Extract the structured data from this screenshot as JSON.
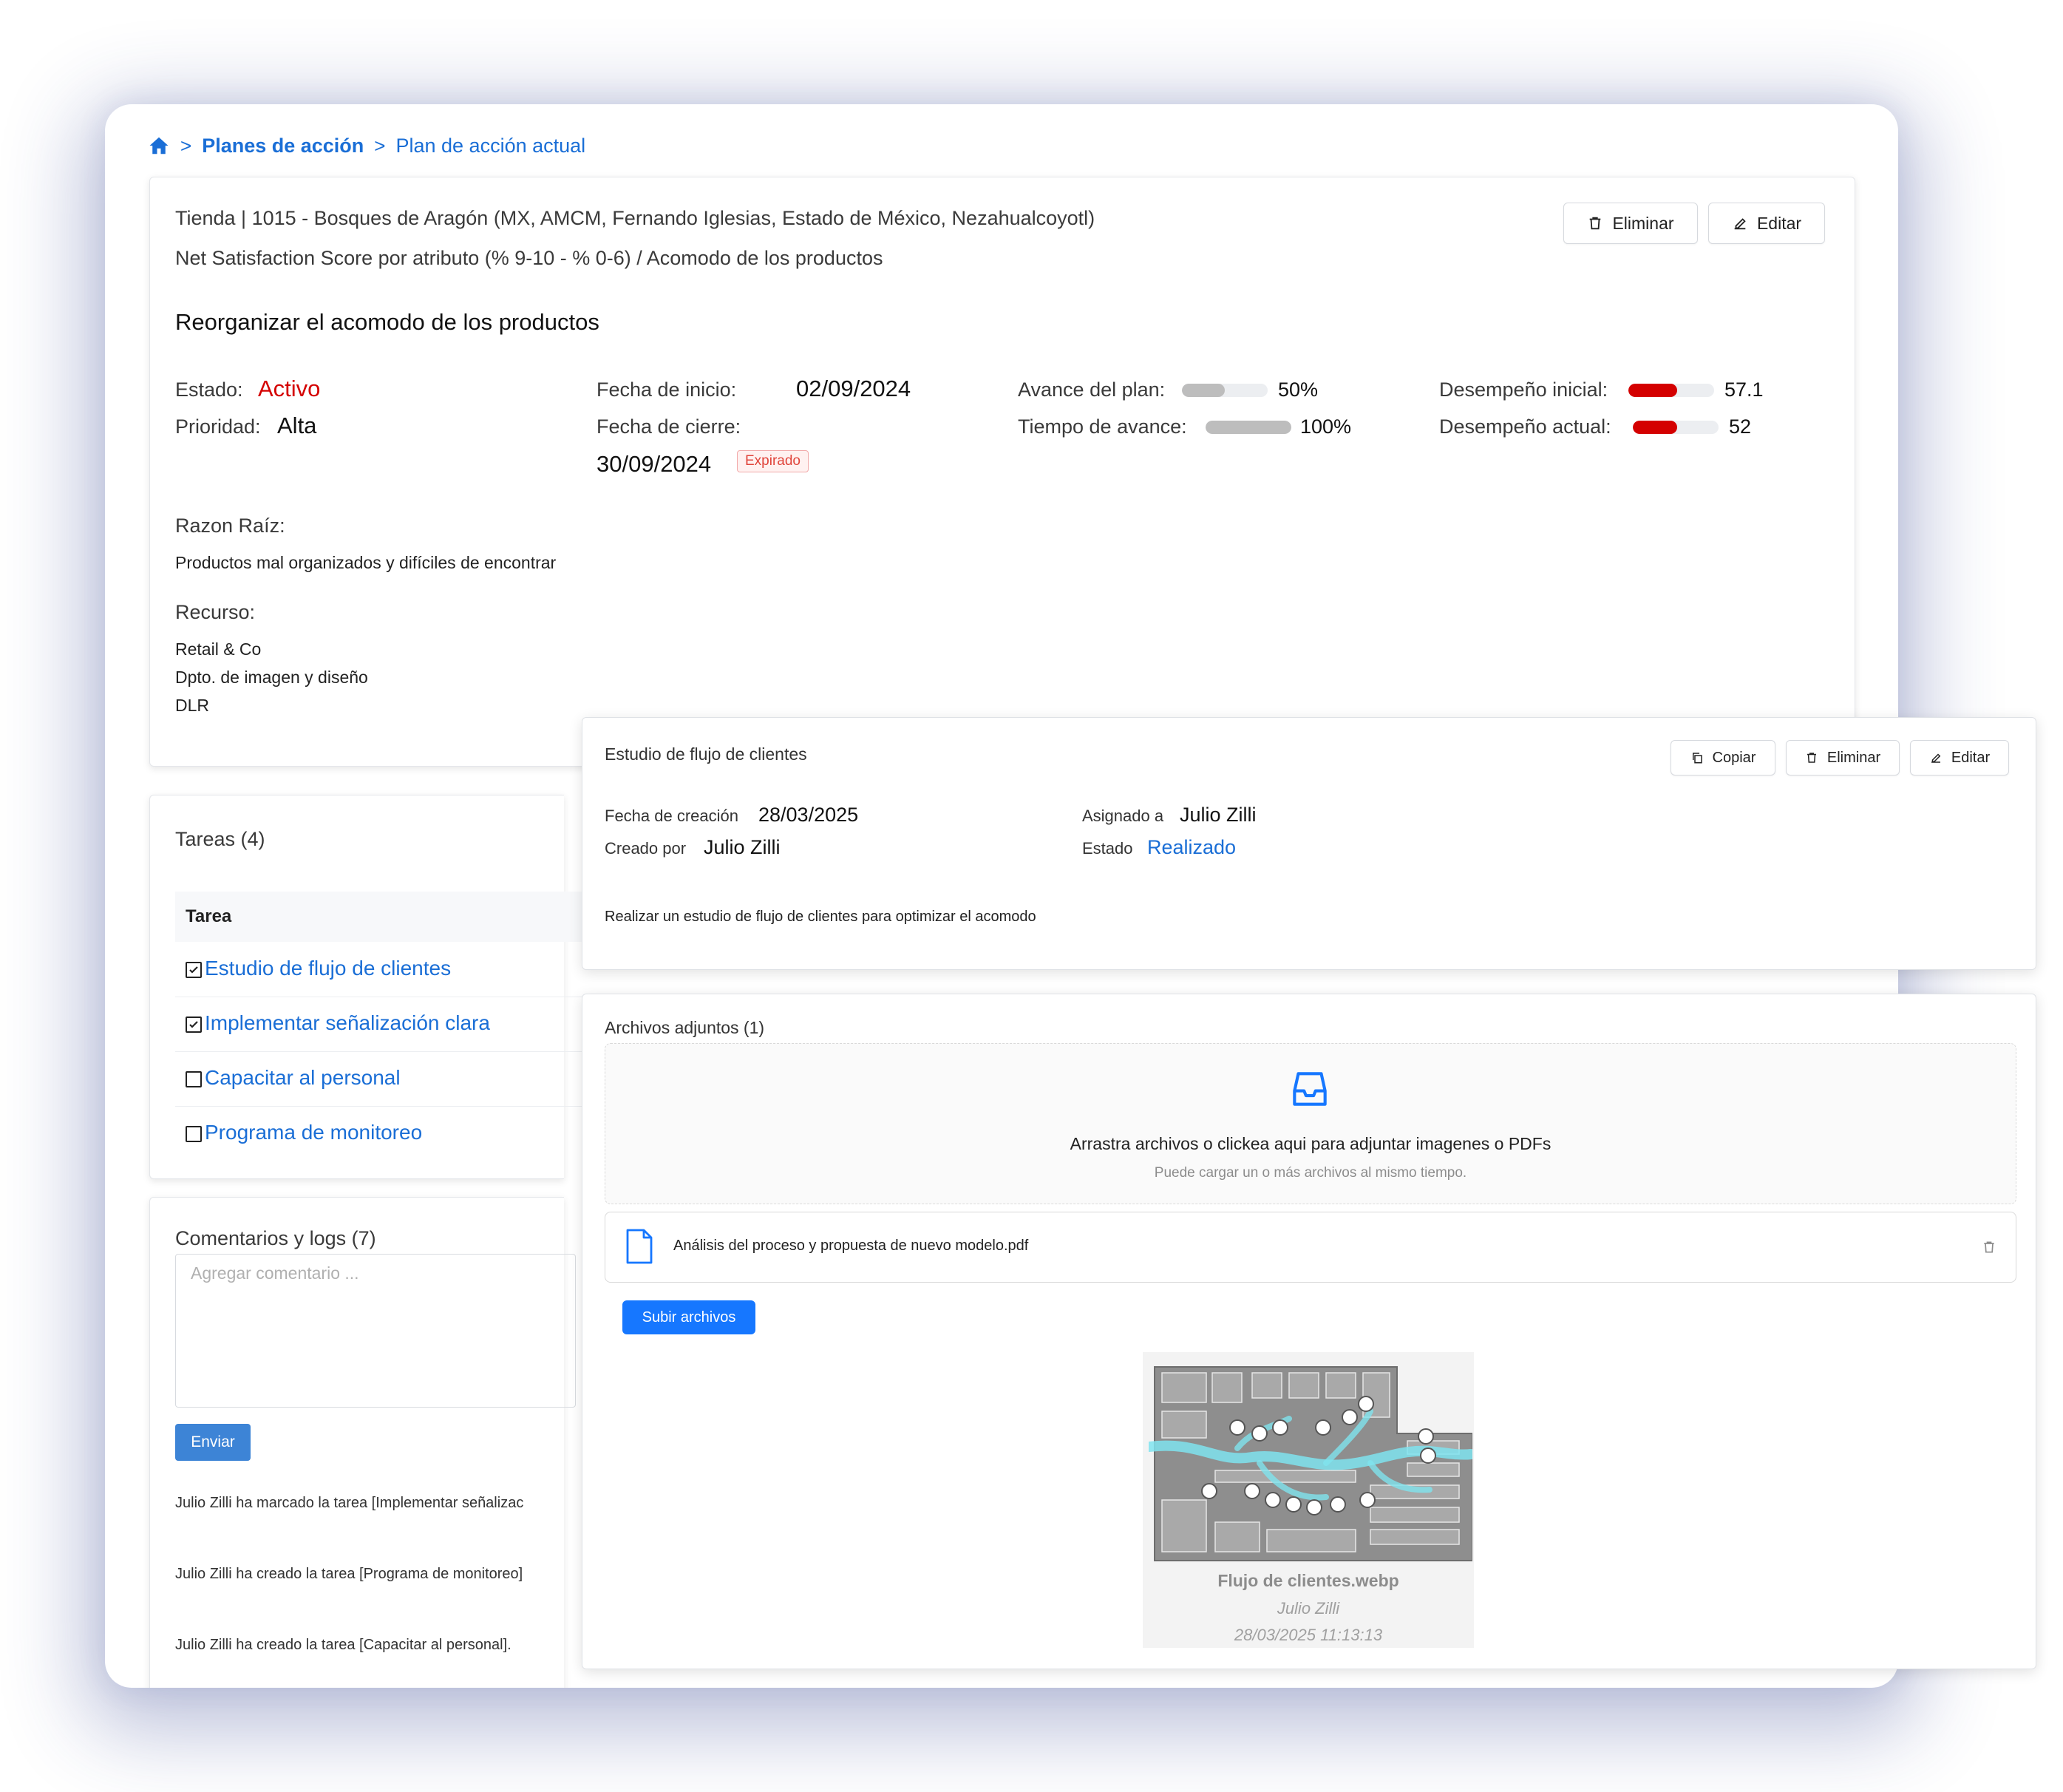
{
  "breadcrumb": {
    "level1": "Planes de acción",
    "level2": "Plan de acción actual",
    "sep": ">"
  },
  "plan": {
    "store_line": "Tienda | 1015 - Bosques de Aragón (MX, AMCM, Fernando Iglesias, Estado de México, Nezahualcoyotl)",
    "metric_line": "Net Satisfaction Score por atributo (% 9-10 - % 0-6) / Acomodo de los productos",
    "title": "Reorganizar el acomodo de los productos",
    "delete_label": "Eliminar",
    "edit_label": "Editar",
    "estado_label": "Estado:",
    "estado_value": "Activo",
    "prioridad_label": "Prioridad:",
    "prioridad_value": "Alta",
    "fecha_inicio_label": "Fecha de inicio:",
    "fecha_inicio_value": "02/09/2024",
    "fecha_cierre_label": "Fecha de cierre:",
    "fecha_cierre_value": "30/09/2024",
    "expired_tag": "Expirado",
    "avance_label": "Avance del plan:",
    "avance_value": "50%",
    "avance_fraction": 0.5,
    "tiempo_label": "Tiempo de avance:",
    "tiempo_value": "100%",
    "tiempo_fraction": 1.0,
    "desempeno_inicial_label": "Desempeño inicial:",
    "desempeno_inicial_value": "57.1",
    "desempeno_inicial_fraction": 0.571,
    "desempeno_actual_label": "Desempeño actual:",
    "desempeno_actual_value": "52",
    "desempeno_actual_fraction": 0.52,
    "razon_label": "Razon Raíz:",
    "razon_value": "Productos mal organizados y difíciles de encontrar",
    "recurso_label": "Recurso:",
    "recursos": [
      "Retail & Co",
      "Dpto. de imagen y diseño",
      "DLR"
    ]
  },
  "colors": {
    "accent": "#1a6ed6",
    "danger": "#d40000",
    "bar_gray": "#bdbdbd",
    "expired": "#e0453b",
    "primary_button": "#1677ff"
  },
  "tasks": {
    "title": "Tareas (4)",
    "column": "Tarea",
    "items": [
      {
        "label": "Estudio de flujo de clientes",
        "checked": true
      },
      {
        "label": "Implementar señalización clara",
        "checked": true
      },
      {
        "label": "Capacitar al personal",
        "checked": false
      },
      {
        "label": "Programa de monitoreo",
        "checked": false
      }
    ]
  },
  "comments": {
    "title": "Comentarios y logs (7)",
    "placeholder": "Agregar comentario ...",
    "send_label": "Enviar",
    "logs": [
      "Julio Zilli ha marcado la tarea [Implementar señalizac",
      "Julio Zilli ha creado la tarea [Programa de monitoreo]",
      "Julio Zilli ha creado la tarea [Capacitar al personal]."
    ]
  },
  "task_detail": {
    "title": "Estudio de flujo de clientes",
    "copy_label": "Copiar",
    "delete_label": "Eliminar",
    "edit_label": "Editar",
    "fecha_creacion_label": "Fecha de creación",
    "fecha_creacion_value": "28/03/2025",
    "creado_por_label": "Creado por",
    "creado_por_value": "Julio Zilli",
    "asignado_label": "Asignado a",
    "asignado_value": "Julio Zilli",
    "estado_label": "Estado",
    "estado_value": "Realizado",
    "description": "Realizar un estudio de flujo de clientes para optimizar el acomodo"
  },
  "attachments": {
    "title": "Archivos adjuntos (1)",
    "drop_text": "Arrastra archivos o clickea aqui para adjuntar imagenes o PDFs",
    "drop_hint": "Puede cargar un o más archivos al mismo tiempo.",
    "file_name": "Análisis del proceso y propuesta de nuevo modelo.pdf",
    "upload_label": "Subir archivos",
    "image": {
      "name": "Flujo de clientes.webp",
      "author": "Julio Zilli",
      "datetime": "28/03/2025 11:13:13"
    }
  }
}
